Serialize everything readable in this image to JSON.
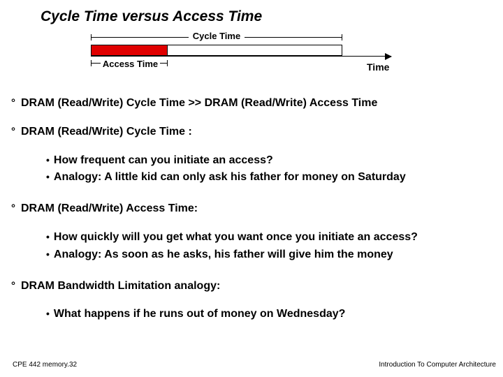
{
  "title": "Cycle Time versus Access Time",
  "diagram": {
    "cycle_label": "Cycle Time",
    "access_label": "Access Time",
    "axis_label": "Time"
  },
  "bullets": [
    {
      "text": "DRAM (Read/Write) Cycle Time  >>  DRAM (Read/Write) Access Time",
      "subs": []
    },
    {
      "text": "DRAM (Read/Write) Cycle Time :",
      "subs": [
        "How frequent can you initiate an access?",
        "Analogy: A little kid can only ask his father for money on Saturday"
      ]
    },
    {
      "text": "DRAM (Read/Write) Access Time:",
      "subs": [
        "How quickly will you get what you want once you initiate an access?",
        "Analogy: As soon as he asks, his father will give him the money"
      ]
    },
    {
      "text": "DRAM Bandwidth Limitation analogy:",
      "subs": [
        "What happens if he runs out of money on Wednesday?"
      ]
    }
  ],
  "footer_left": "CPE 442  memory.32",
  "footer_right": "Introduction To Computer Architecture"
}
